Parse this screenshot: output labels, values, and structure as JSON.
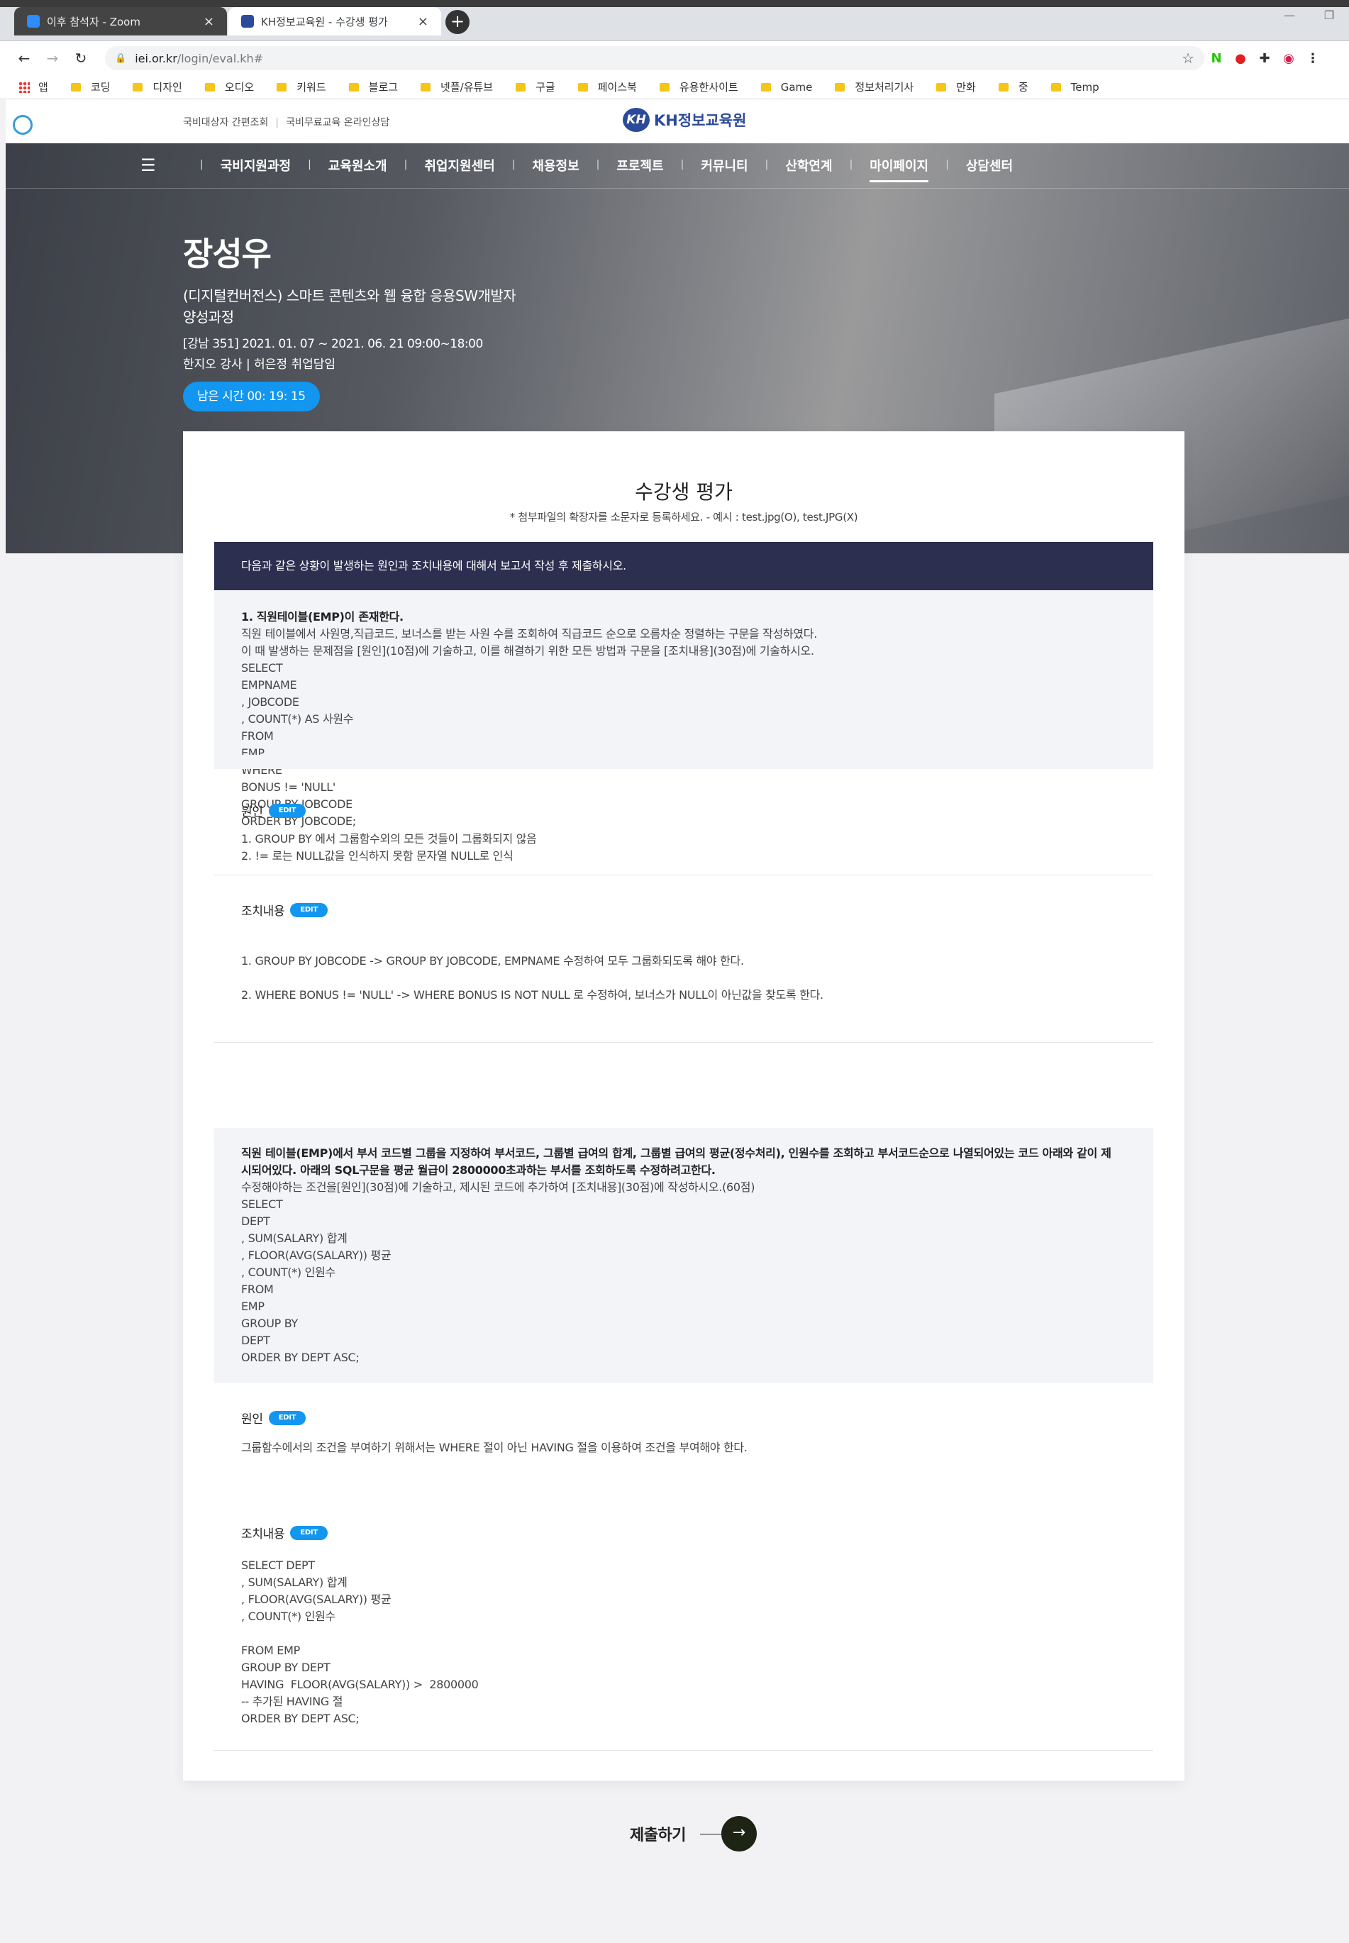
{
  "browser": {
    "tabs": [
      {
        "title": "이후 참석자 - Zoom",
        "active": false
      },
      {
        "title": "KH정보교육원 - 수강생 평가",
        "active": true
      }
    ],
    "new_tab": "+",
    "window_controls": [
      "—",
      "❐"
    ],
    "url_host": "iei.or.kr",
    "url_path": "/login/eval.kh#",
    "bookmarks": [
      "앱",
      "코딩",
      "디자인",
      "오디오",
      "키워드",
      "블로그",
      "넷플/유튜브",
      "구글",
      "페이스북",
      "유용한사이트",
      "Game",
      "정보처리기사",
      "만화",
      "중",
      "Temp"
    ]
  },
  "site": {
    "top_links": [
      "국비대상자 간편조회",
      "국비무료교육 온라인상담"
    ],
    "brand_mark": "KH",
    "brand_name": "KH정보교육원",
    "menu": [
      "국비지원과정",
      "교육원소개",
      "취업지원센터",
      "채용정보",
      "프로젝트",
      "커뮤니티",
      "산학연계",
      "마이페이지",
      "상담센터"
    ],
    "active_menu": "마이페이지"
  },
  "student": {
    "name": "장성우",
    "course": "(디지털컨버전스) 스마트 콘텐츠와 웹 융합 응용SW개발자 양성과정",
    "period": "[강남 351] 2021. 01. 07 ~ 2021. 06. 21 09:00~18:00",
    "teachers": "한지오 강사 | 허은정 취업담임",
    "timer": "남은 시간 00: 19: 15"
  },
  "eval": {
    "title": "수강생 평가",
    "note": "* 첨부파일의 확장자를 소문자로 등록하세요. - 예시 : test.jpg(O), test.JPG(X)",
    "instruction": "다음과 같은 상황이 발생하는 원인과 조치내용에 대해서 보고서 작성 후 제출하시오.",
    "edit_label": "EDIT",
    "q1": {
      "title": "1. 직원테이블(EMP)이 존재한다.",
      "lines": [
        "직원 테이블에서 사원명,직급코드, 보너스를 받는 사원 수를 조회하여 직급코드 순으로 오름차순 정렬하는 구문을 작성하였다.",
        "이 때 발생하는 문제점을 [원인](10점)에 기술하고, 이를 해결하기 위한 모든 방법과 구문을 [조치내용](30점)에 기술하시오.",
        "SELECT",
        "EMPNAME",
        ", JOBCODE",
        ", COUNT(*) AS 사원수",
        "FROM",
        "EMP",
        "WHERE",
        "BONUS != 'NULL'",
        "GROUP BY JOBCODE",
        "ORDER BY JOBCODE;"
      ],
      "cause_label": "원인",
      "cause": [
        "1. GROUP BY 에서 그룹함수외의 모든 것들이 그룹화되지 않음",
        "2. != 로는 NULL값을 인식하지 못함 문자열 NULL로 인식"
      ],
      "action_label": "조치내용",
      "action": [
        "1. GROUP BY JOBCODE -> GROUP BY JOBCODE, EMPNAME 수정하여 모두 그룹화되도록 해야 한다.",
        "",
        "2. WHERE BONUS != 'NULL' -> WHERE BONUS IS NOT NULL 로 수정하여, 보너스가 NULL이 아닌값을 찾도록 한다."
      ]
    },
    "q2": {
      "title_lines": [
        "직원 테이블(EMP)에서 부서 코드별 그룹을 지정하여 부서코드, 그룹별 급여의 합계, 그룹별 급여의 평균(정수처리), 인원수를 조회하고 부서코드순으로 나열되어있는 코드 아래와 같이 제",
        "시되어있다. 아래의 SQL구문을 평균 월급이 2800000초과하는 부서를 조회하도록 수정하려고한다."
      ],
      "lines": [
        "수정해야하는 조건을[원인](30점)에 기술하고, 제시된 코드에 추가하여 [조치내용](30점)에 작성하시오.(60점)",
        "SELECT",
        "DEPT",
        ", SUM(SALARY) 합계",
        ", FLOOR(AVG(SALARY)) 평균",
        ", COUNT(*) 인원수",
        "FROM",
        "EMP",
        "GROUP BY",
        "DEPT",
        "ORDER BY DEPT ASC;"
      ],
      "cause_label": "원인",
      "cause": [
        "그룹함수에서의 조건을 부여하기 위해서는 WHERE 절이 아닌 HAVING 절을 이용하여 조건을 부여해야 한다."
      ],
      "action_label": "조치내용",
      "action": [
        "SELECT DEPT",
        ", SUM(SALARY) 합계",
        ", FLOOR(AVG(SALARY)) 평균",
        ", COUNT(*) 인원수",
        "",
        "FROM EMP",
        "GROUP BY DEPT",
        "HAVING  FLOOR(AVG(SALARY)) >  2800000",
        "-- 추가된 HAVING 절",
        "ORDER BY DEPT ASC;"
      ]
    },
    "submit_label": "제출하기",
    "submit_arrow": "→"
  },
  "colors": {
    "accent_blue": "#1296f0",
    "banner_navy": "#2c2f4f",
    "brand_blue": "#2c4a9a"
  }
}
